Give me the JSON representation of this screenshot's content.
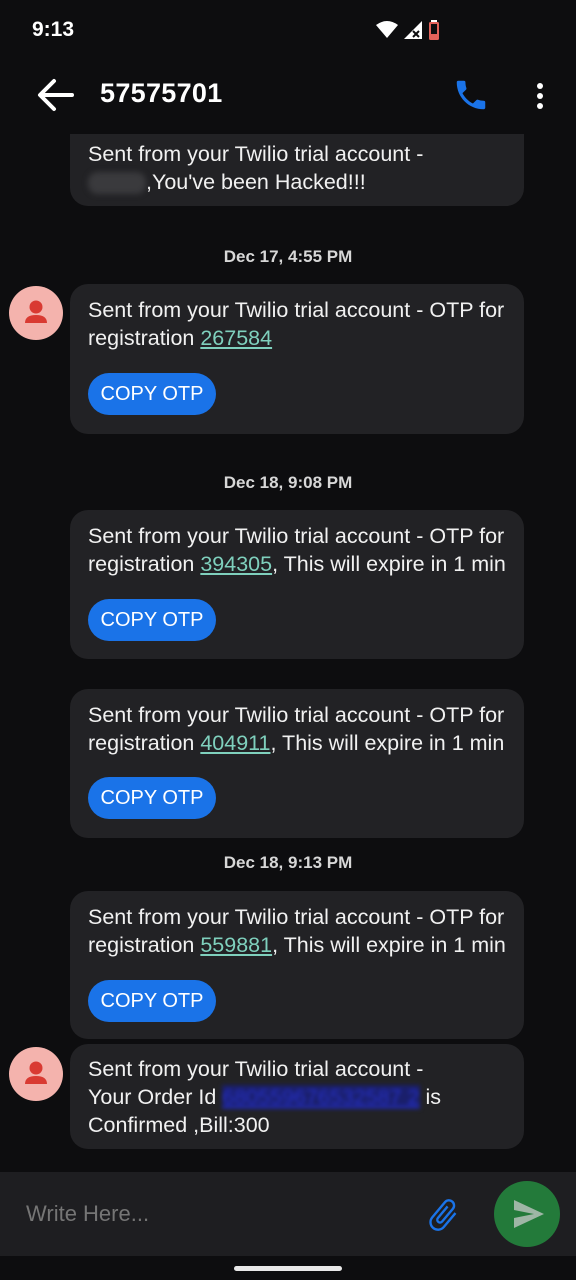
{
  "status": {
    "time": "9:13"
  },
  "header": {
    "title": "57575701"
  },
  "messages": [
    {
      "line1": "Sent from your Twilio trial account -",
      "line2_suffix": ",You've been Hacked!!!"
    },
    {
      "date": "Dec 17, 4:55 PM"
    },
    {
      "line1": "Sent from your Twilio trial account - OTP for",
      "line2_prefix": "registration ",
      "otp": "267584",
      "button": "COPY OTP"
    },
    {
      "date": "Dec 18, 9:08 PM"
    },
    {
      "line1": "Sent from your Twilio trial account - OTP for",
      "line2_prefix": "registration ",
      "otp": "394305",
      "line2_suffix": ", This will expire in 1 min",
      "button": "COPY OTP"
    },
    {
      "line1": "Sent from your Twilio trial account - OTP for",
      "line2_prefix": "registration ",
      "otp": "404911",
      "line2_suffix": ", This will expire in 1 min",
      "button": "COPY OTP"
    },
    {
      "date": "Dec 18, 9:13 PM"
    },
    {
      "line1": "Sent from your Twilio trial account - OTP for",
      "line2_prefix": "registration ",
      "otp": "559881",
      "line2_suffix": ", This will expire in 1 min",
      "button": "COPY OTP"
    },
    {
      "line1": "Sent from your Twilio trial account -",
      "line2_prefix": "Your Order Id ",
      "order_id": "680559676532587 2",
      "line2_suffix": " is",
      "line3": "Confirmed ,Bill:300"
    }
  ],
  "composer": {
    "placeholder": "Write Here..."
  },
  "colors": {
    "accent": "#1a73e8",
    "send": "#237a3a",
    "otp_link": "#7fd0bd",
    "bubble": "#222225",
    "avatar": "#f4b3ad"
  },
  "icons": [
    "back-arrow-icon",
    "phone-icon",
    "more-vert-icon",
    "person-icon",
    "paperclip-icon",
    "send-icon",
    "wifi-icon",
    "signal-icon",
    "battery-icon"
  ]
}
